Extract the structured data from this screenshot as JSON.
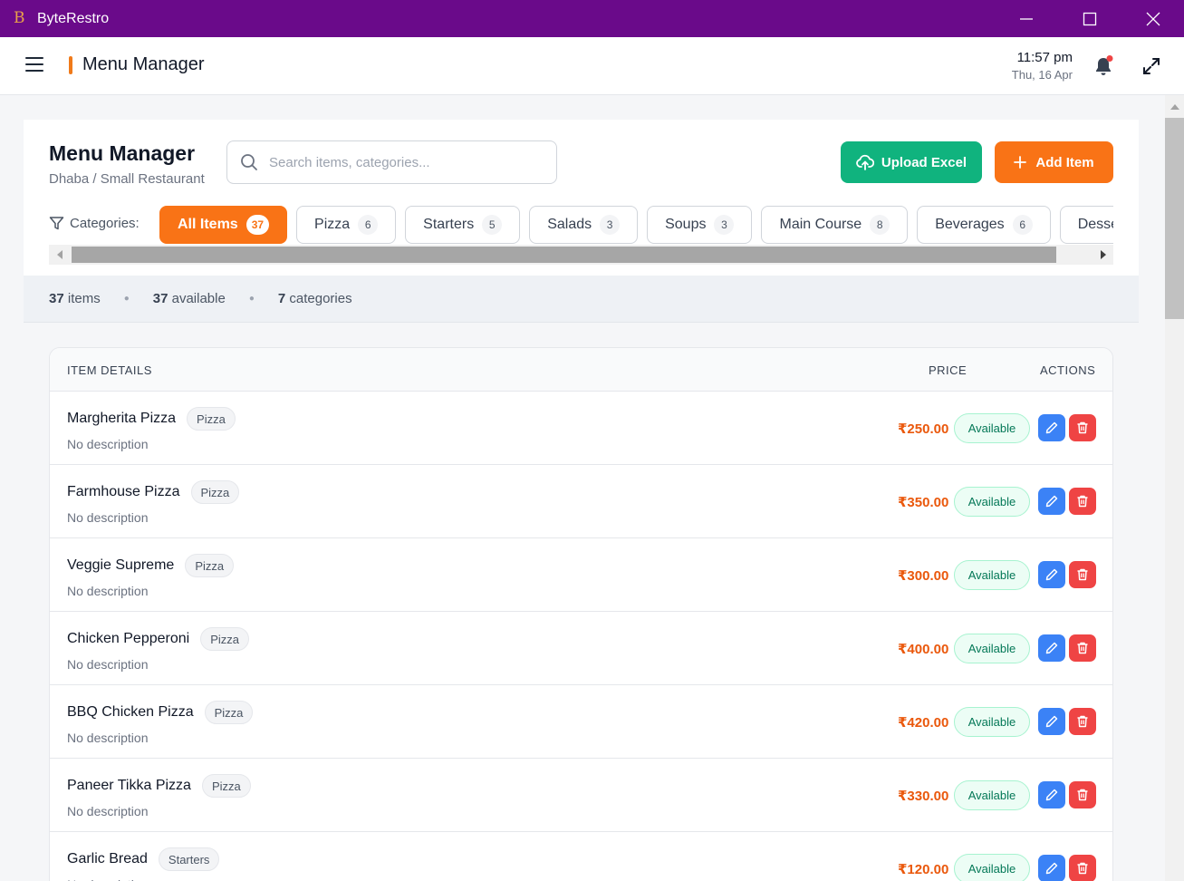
{
  "window": {
    "logo": "B",
    "app_name": "ByteRestro"
  },
  "header": {
    "title": "Menu Manager",
    "time": "11:57 pm",
    "date": "Thu, 16 Apr",
    "has_notification": true
  },
  "page": {
    "title": "Menu Manager",
    "subtitle": "Dhaba / Small Restaurant",
    "search_placeholder": "Search items, categories...",
    "upload_label": "Upload Excel",
    "add_label": "Add Item",
    "categories_label": "Categories:"
  },
  "categories": [
    {
      "label": "All Items",
      "count": "37",
      "active": true
    },
    {
      "label": "Pizza",
      "count": "6",
      "active": false
    },
    {
      "label": "Starters",
      "count": "5",
      "active": false
    },
    {
      "label": "Salads",
      "count": "3",
      "active": false
    },
    {
      "label": "Soups",
      "count": "3",
      "active": false
    },
    {
      "label": "Main Course",
      "count": "8",
      "active": false
    },
    {
      "label": "Beverages",
      "count": "6",
      "active": false
    },
    {
      "label": "Desserts",
      "count": "",
      "active": false
    }
  ],
  "stats": {
    "items_count": "37",
    "items_label": "items",
    "available_count": "37",
    "available_label": "available",
    "categories_count": "7",
    "categories_label": "categories"
  },
  "table": {
    "headers": {
      "details": "ITEM DETAILS",
      "price": "PRICE",
      "actions": "ACTIONS"
    },
    "rows": [
      {
        "name": "Margherita Pizza",
        "category": "Pizza",
        "description": "No description",
        "price": "₹250.00",
        "status": "Available"
      },
      {
        "name": "Farmhouse Pizza",
        "category": "Pizza",
        "description": "No description",
        "price": "₹350.00",
        "status": "Available"
      },
      {
        "name": "Veggie Supreme",
        "category": "Pizza",
        "description": "No description",
        "price": "₹300.00",
        "status": "Available"
      },
      {
        "name": "Chicken Pepperoni",
        "category": "Pizza",
        "description": "No description",
        "price": "₹400.00",
        "status": "Available"
      },
      {
        "name": "BBQ Chicken Pizza",
        "category": "Pizza",
        "description": "No description",
        "price": "₹420.00",
        "status": "Available"
      },
      {
        "name": "Paneer Tikka Pizza",
        "category": "Pizza",
        "description": "No description",
        "price": "₹330.00",
        "status": "Available"
      },
      {
        "name": "Garlic Bread",
        "category": "Starters",
        "description": "No description",
        "price": "₹120.00",
        "status": "Available"
      }
    ]
  },
  "colors": {
    "titlebar": "#6a0a8a",
    "accent": "#f97316",
    "upload": "#10b37e",
    "edit": "#3b82f6",
    "delete": "#ef4444"
  }
}
